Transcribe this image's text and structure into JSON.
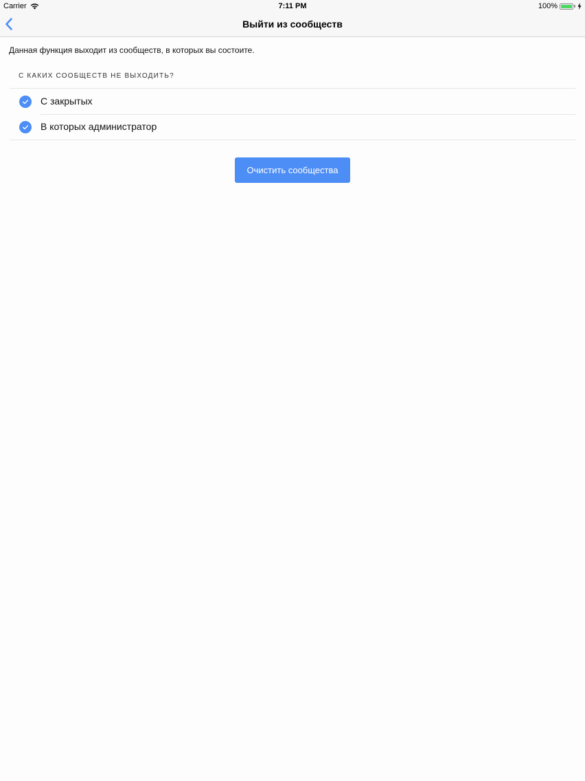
{
  "status_bar": {
    "carrier": "Carrier",
    "time": "7:11 PM",
    "battery": "100%",
    "battery_level_percent": 100,
    "battery_color": "#4cd964"
  },
  "nav": {
    "back_icon": "chevron-left-icon",
    "title": "Выйти из сообществ"
  },
  "description": "Данная функция выходит из сообществ, в которых вы состоите.",
  "section_header": "С КАКИХ СООБЩЕСТВ НЕ ВЫХОДИТЬ?",
  "options": [
    {
      "label": "С закрытых",
      "checked": true
    },
    {
      "label": "В которых администратор",
      "checked": true
    }
  ],
  "clear_button": {
    "label": "Очистить сообщества"
  },
  "colors": {
    "accent": "#4c8df6",
    "nav_background": "#f7f7f8"
  }
}
